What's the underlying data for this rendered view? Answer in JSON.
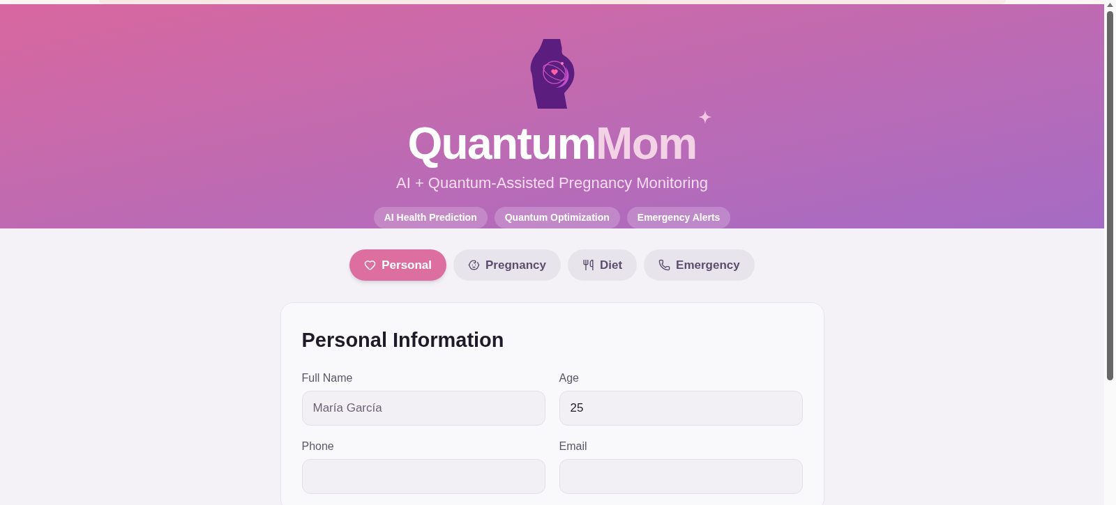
{
  "header": {
    "brand_first": "Quantum",
    "brand_second": "Mom",
    "subtitle": "AI + Quantum-Assisted Pregnancy Monitoring",
    "badges": [
      "AI Health Prediction",
      "Quantum Optimization",
      "Emergency Alerts"
    ]
  },
  "tabs": [
    {
      "label": "Personal",
      "selected": true
    },
    {
      "label": "Pregnancy",
      "selected": false
    },
    {
      "label": "Diet",
      "selected": false
    },
    {
      "label": "Emergency",
      "selected": false
    }
  ],
  "card": {
    "title": "Personal Information",
    "fields": [
      {
        "label": "Full Name",
        "placeholder": "María García"
      },
      {
        "label": "Age",
        "value": "25"
      },
      {
        "label": "Phone"
      },
      {
        "label": "Email"
      }
    ]
  }
}
